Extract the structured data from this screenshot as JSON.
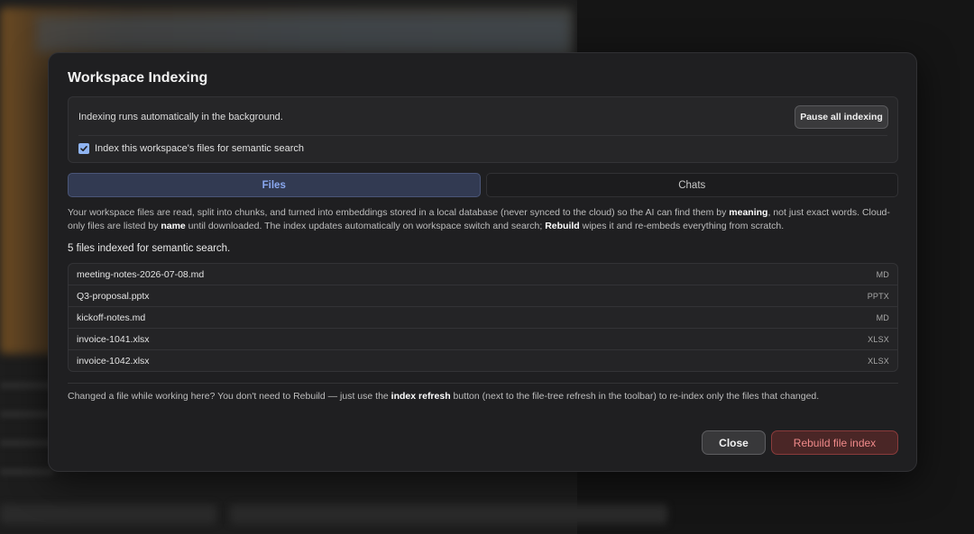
{
  "dialog": {
    "title": "Workspace Indexing"
  },
  "auto_indexing": {
    "status_text": "Indexing runs automatically in the background.",
    "pause_label": "Pause all indexing",
    "checkbox_label": "Index this workspace's files for semantic search",
    "checkbox_checked": true
  },
  "tabs": [
    {
      "label": "Files",
      "active": true
    },
    {
      "label": "Chats",
      "active": false
    }
  ],
  "description": {
    "p1": "Your workspace files are read, split into chunks, and turned into embeddings stored in a local database (never synced to the cloud) so the AI can find them by ",
    "b1": "meaning",
    "p2": ", not just exact words. Cloud-only files are listed by ",
    "b2": "name",
    "p3": " until downloaded. The index updates automatically on workspace switch and search; ",
    "b3": "Rebuild",
    "p4": " wipes it and re-embeds everything from scratch."
  },
  "count_text": "5 files indexed for semantic search.",
  "files": [
    {
      "name": "meeting-notes-2026-07-08.md",
      "type": "MD"
    },
    {
      "name": "Q3-proposal.pptx",
      "type": "PPTX"
    },
    {
      "name": "kickoff-notes.md",
      "type": "MD"
    },
    {
      "name": "invoice-1041.xlsx",
      "type": "XLSX"
    },
    {
      "name": "invoice-1042.xlsx",
      "type": "XLSX"
    }
  ],
  "note": {
    "p1": "Changed a file while working here? You don't need to Rebuild — just use the ",
    "b1": "index refresh",
    "p2": " button (next to the file-tree refresh in the toolbar) to re-index only the files that changed."
  },
  "footer": {
    "close_label": "Close",
    "rebuild_label": "Rebuild file index"
  },
  "colors": {
    "accent": "#8aa8f0",
    "danger": "#f08a8a"
  }
}
